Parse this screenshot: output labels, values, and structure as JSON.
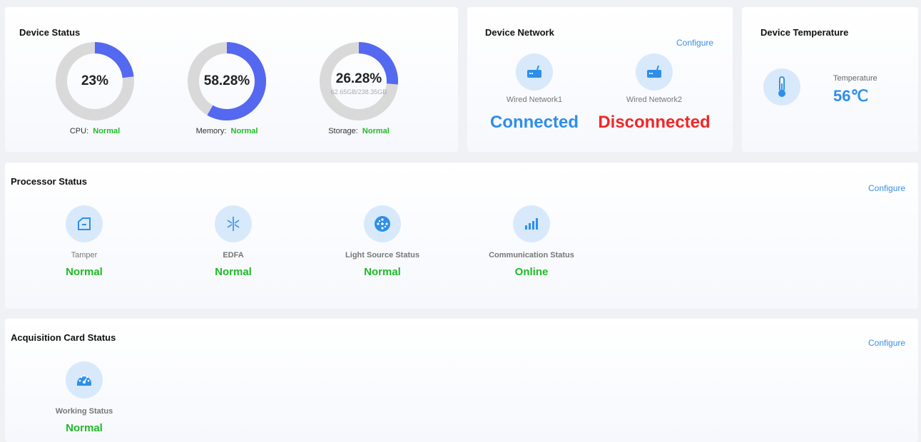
{
  "device_status": {
    "title": "Device Status",
    "cpu": {
      "value": 23,
      "percent_text": "23%",
      "label": "CPU:",
      "status": "Normal"
    },
    "memory": {
      "value": 58.28,
      "percent_text": "58.28%",
      "label": "Memory:",
      "status": "Normal"
    },
    "storage": {
      "value": 26.28,
      "percent_text": "26.28%",
      "detail": "62.65GB/238.35GB",
      "label": "Storage:",
      "status": "Normal"
    }
  },
  "device_network": {
    "title": "Device Network",
    "configure": "Configure",
    "wired1": {
      "label": "Wired Network1",
      "status": "Connected",
      "icon": "router-icon"
    },
    "wired2": {
      "label": "Wired Network2",
      "status": "Disconnected",
      "icon": "router-icon"
    }
  },
  "device_temperature": {
    "title": "Device Temperature",
    "label": "Temperature",
    "value": "56℃",
    "icon": "thermometer-icon"
  },
  "processor_status": {
    "title": "Processor Status",
    "configure": "Configure",
    "items": [
      {
        "label": "Tamper",
        "value": "Normal",
        "icon": "tamper-icon"
      },
      {
        "label": "EDFA",
        "value": "Normal",
        "icon": "edfa-icon"
      },
      {
        "label": "Light Source Status",
        "value": "Normal",
        "icon": "light-source-icon"
      },
      {
        "label": "Communication Status",
        "value": "Online",
        "icon": "signal-bars-icon"
      }
    ]
  },
  "acquisition_card_status": {
    "title": "Acquisition Card Status",
    "configure": "Configure",
    "items": [
      {
        "label": "Working Status",
        "value": "Normal",
        "icon": "gauge-icon"
      }
    ]
  },
  "colors": {
    "accent": "#3b8fe6",
    "ok": "#1fbb26",
    "error": "#f22626",
    "connected": "#2e8fe8",
    "gauge_fill": "#5468f0",
    "gauge_track": "#d9d9d9",
    "icon_bg": "#d8e9fb"
  }
}
